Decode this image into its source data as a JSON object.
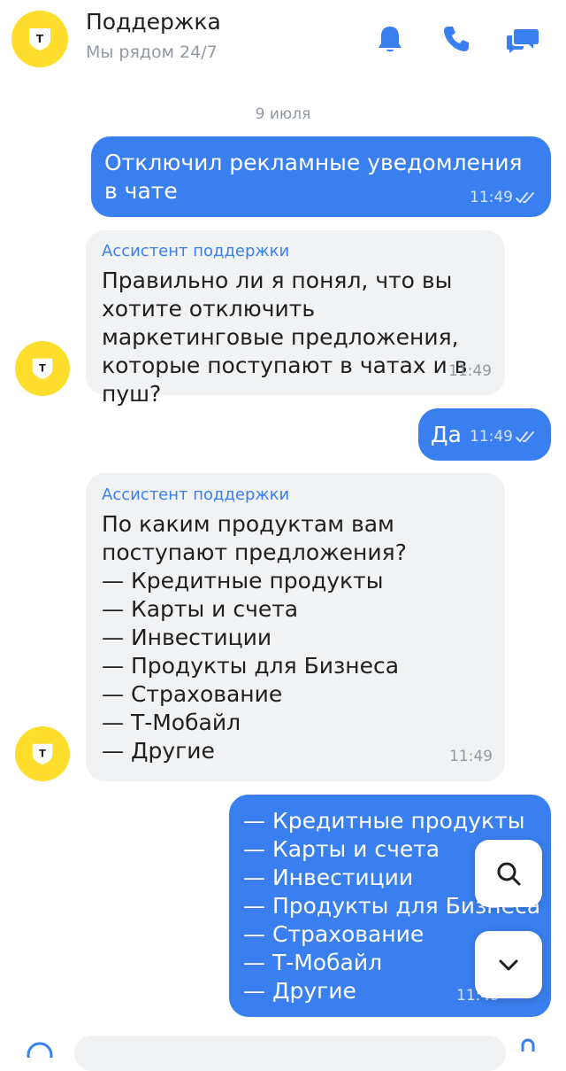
{
  "header": {
    "logo_letter": "T",
    "title": "Поддержка",
    "subtitle": "Мы рядом 24/7",
    "icons": [
      "bell-icon",
      "phone-icon",
      "chat-icon"
    ]
  },
  "date_separator": "9 июля",
  "messages": [
    {
      "direction": "out",
      "text": "Отключил рекламные уведомления в чате",
      "time": "11:49",
      "status": "read"
    },
    {
      "direction": "in",
      "sender": "Ассистент поддержки",
      "text": "Правильно ли я понял, что вы хотите отключить маркетинговые предложения, которые поступают в чатах и в пуш?",
      "time": "11:49"
    },
    {
      "direction": "out",
      "text": "Да",
      "time": "11:49",
      "status": "read"
    },
    {
      "direction": "in",
      "sender": "Ассистент поддержки",
      "text": "По каким продуктам вам поступают предложения?\n— Кредитные продукты\n— Карты и счета\n— Инвестиции\n— Продукты для Бизнеса\n— Страхование\n— Т-Мобайл\n— Другие",
      "time": "11:49"
    },
    {
      "direction": "out",
      "text": "— Кредитные продукты\n— Карты и счета\n— Инвестиции\n— Продукты для Бизнеса\n— Страхование\n— Т-Мобайл\n— Другие",
      "time": "11:49"
    }
  ],
  "colors": {
    "accent": "#3a7ff0",
    "brand_yellow": "#ffdd2d",
    "incoming_bubble": "#f1f2f4",
    "muted_text": "#9299a2"
  }
}
